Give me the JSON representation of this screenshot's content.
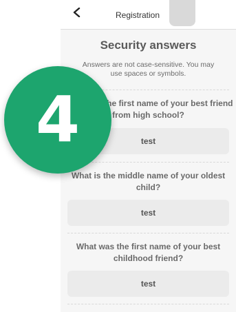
{
  "nav": {
    "title": "Registration",
    "back_icon": "chevron-left-icon"
  },
  "section": {
    "title": "Security answers",
    "subtitle": "Answers are not case-sensitive. You may use spaces or symbols."
  },
  "qas": [
    {
      "question": "What was the first name of your best friend from high school?",
      "answer": "test"
    },
    {
      "question": "What is the middle name of your oldest child?",
      "answer": "test"
    },
    {
      "question": "What was the first name of your best childhood friend?",
      "answer": "test"
    }
  ],
  "step_badge": {
    "number": "4",
    "color": "#1da56e"
  }
}
